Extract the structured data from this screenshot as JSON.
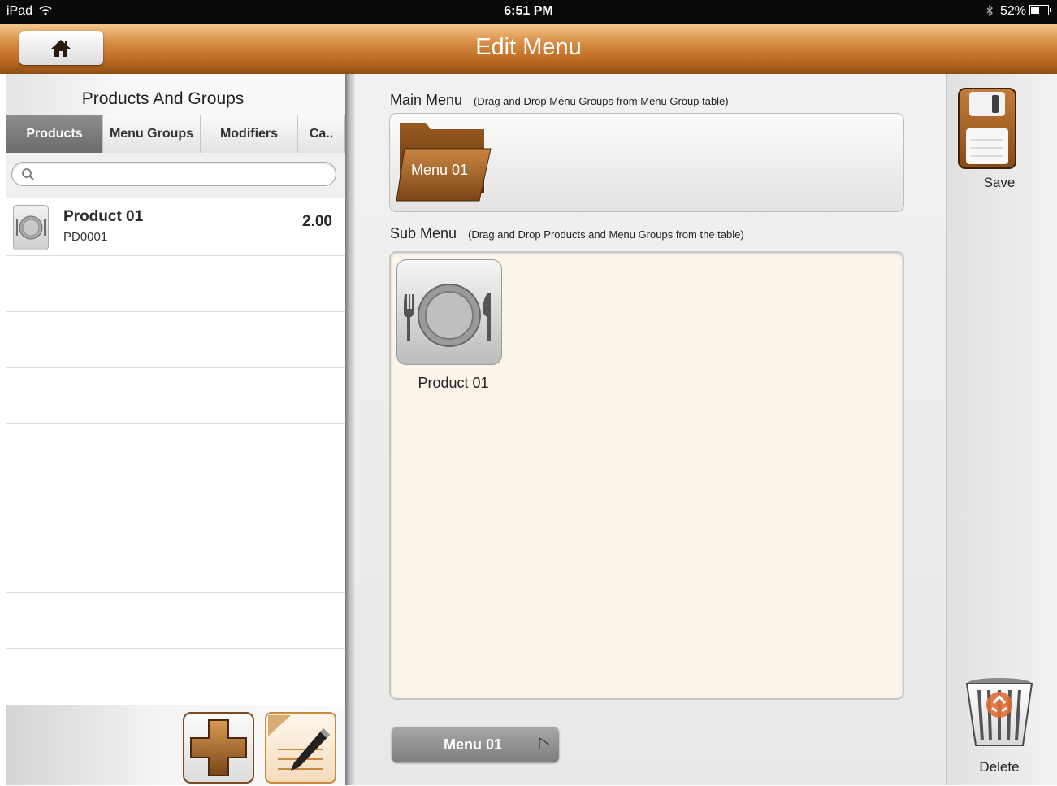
{
  "status_bar": {
    "device": "iPad",
    "time": "6:51 PM",
    "battery": "52%"
  },
  "title_bar": {
    "title": "Edit Menu"
  },
  "left_panel": {
    "header": "Products And Groups",
    "tabs": [
      {
        "label": "Products",
        "active": true
      },
      {
        "label": "Menu Groups",
        "active": false
      },
      {
        "label": "Modifiers",
        "active": false
      },
      {
        "label": "Ca..",
        "active": false
      }
    ],
    "search": {
      "placeholder": ""
    },
    "products": [
      {
        "name": "Product 01",
        "code": "PD0001",
        "price": "2.00"
      }
    ]
  },
  "main_menu": {
    "title": "Main Menu",
    "hint": "(Drag and Drop Menu Groups from Menu Group table)",
    "groups": [
      {
        "label": "Menu 01"
      }
    ]
  },
  "sub_menu": {
    "title": "Sub Menu",
    "hint": "(Drag and Drop Products and Menu Groups from the table)",
    "items": [
      {
        "label": "Product 01"
      }
    ]
  },
  "bottom_tab": {
    "label": "Menu 01"
  },
  "right_panel": {
    "save_label": "Save",
    "delete_label": "Delete"
  },
  "colors": {
    "accent_brown": "#b96820",
    "sub_menu_bg": "#fcf4e9"
  },
  "icons": [
    "home-icon",
    "search-icon",
    "plate-icon",
    "folder-icon",
    "plus-icon",
    "edit-note-icon",
    "save-disk-icon",
    "recycle-bin-icon",
    "wifi-icon",
    "bluetooth-icon",
    "battery-icon"
  ]
}
